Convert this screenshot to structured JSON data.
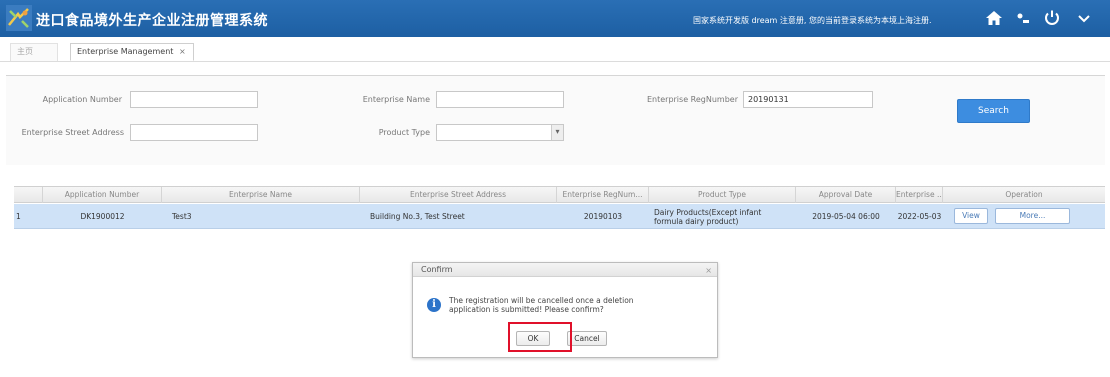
{
  "header": {
    "title": "进口食品境外生产企业注册管理系统",
    "user_message": "国家系统开发版 dream 注意册, 您的当前登录系统为本境上海注册.",
    "icons": [
      "home-icon",
      "settings-icon",
      "power-icon",
      "chevron-down-icon"
    ],
    "colors": {
      "bar": "#1d5fa3"
    }
  },
  "tabs": [
    {
      "label": "主页"
    },
    {
      "label": "Enterprise Management",
      "close": "×"
    }
  ],
  "search": {
    "application_number_label": "Application Number",
    "application_number_value": "",
    "enterprise_name_label": "Enterprise Name",
    "enterprise_name_value": "",
    "enterprise_regnumber_label": "Enterprise RegNumber",
    "enterprise_regnumber_value": "20190131",
    "street_address_label": "Enterprise Street Address",
    "street_address_value": "",
    "product_type_label": "Product Type",
    "product_type_value": "",
    "search_button": "Search"
  },
  "table": {
    "columns": [
      "Application Number",
      "Enterprise Name",
      "Enterprise Street Address",
      "Enterprise RegNum...",
      "Product Type",
      "Approval Date",
      "Enterprise ...",
      "Operation"
    ],
    "rows": [
      {
        "index": "1",
        "application_number": "DK1900012",
        "enterprise_name": "Test3",
        "street_address": "Building No.3, Test Street",
        "reg_number": "20190103",
        "product_type": "Dairy Products(Except infant formula dairy product)",
        "approval_date": "2019-05-04 06:00",
        "enterprise_date": "2022-05-03",
        "view_button": "View",
        "more_button": "More..."
      }
    ]
  },
  "dialog": {
    "title": "Confirm",
    "close": "×",
    "message": "The registration will be cancelled once a deletion application is submitted! Please confirm?",
    "ok_button": "OK",
    "cancel_button": "Cancel",
    "icon": "info-icon"
  }
}
